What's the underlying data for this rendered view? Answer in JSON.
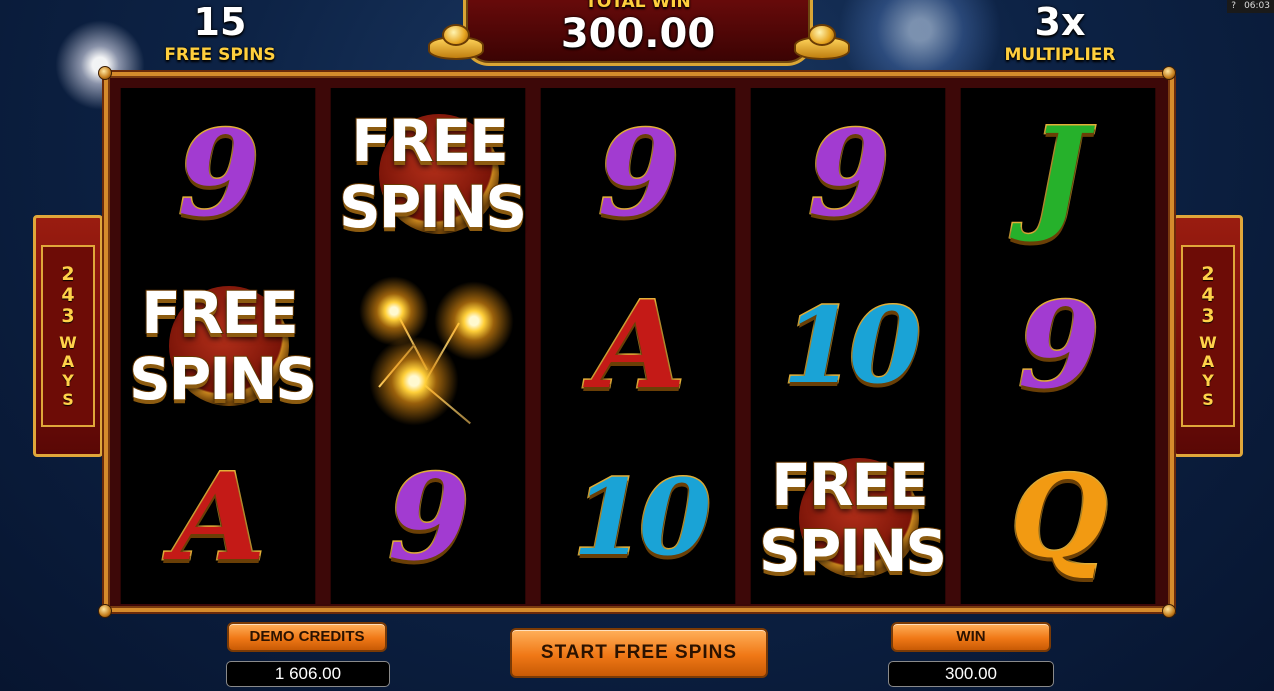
{
  "hud": {
    "free_spins_count": "15",
    "free_spins_label": "FREE SPINS",
    "total_win_label": "TOTAL WIN",
    "total_win_value": "300.00",
    "multiplier_value": "3x",
    "multiplier_label": "MULTIPLIER"
  },
  "system_bar": {
    "help": "?",
    "time": "06:03"
  },
  "side_banners": {
    "left": {
      "number": "243",
      "label": "WAYS"
    },
    "right": {
      "number": "243",
      "label": "WAYS"
    }
  },
  "reels": [
    [
      "9",
      "FREE SPINS",
      "A"
    ],
    [
      "FREE SPINS",
      "sparkler",
      "9"
    ],
    [
      "9",
      "A",
      "10"
    ],
    [
      "9",
      "10",
      "FREE SPINS"
    ],
    [
      "J",
      "9",
      "Q"
    ]
  ],
  "symbol_text": {
    "free_line1": "FREE",
    "free_line2": "SPINS"
  },
  "bottom": {
    "credits_label": "DEMO CREDITS",
    "credits_value": "1 606.00",
    "start_label": "START FREE SPINS",
    "win_label": "WIN",
    "win_value": "300.00"
  },
  "colors": {
    "accent_orange": "#f07816",
    "frame_gold": "#d58b2c",
    "label_yellow": "#ffcf3d"
  }
}
